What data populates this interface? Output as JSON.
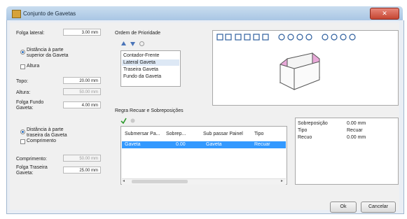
{
  "window": {
    "title": "Conjunto de Gavetas",
    "close_label": "✕"
  },
  "left": {
    "folga_lateral_label": "Folga lateral:",
    "folga_lateral_value": "3.00 mm",
    "radio_top_label": "Distância à parte superior da Gaveta",
    "check_altura_label": "Altura",
    "topo_label": "Topo:",
    "topo_value": "20.00 mm",
    "altura_label": "Altura:",
    "altura_value": "50.00 mm",
    "folga_fundo_label": "Folga Fundo Gaveta:",
    "folga_fundo_value": "4.00 mm",
    "radio_back_label": "Distância à parte traseira da Gaveta",
    "check_comprimento_label": "Comprimento",
    "comprimento_label": "Comprimento:",
    "comprimento_value": "50.00 mm",
    "folga_traseira_label": "Folga Traseira Gaveta:",
    "folga_traseira_value": "25.00 mm"
  },
  "ordem": {
    "title": "Ordem de Prioridade",
    "items": [
      "Contador-Frente",
      "Lateral Gaveta",
      "Traseira Gaveta",
      "Fundo da Gaveta"
    ],
    "selected_index": 1
  },
  "regra": {
    "title": "Regra Recuar e Sobreposições",
    "columns": [
      "Submersar Pa...",
      "Sobrep...",
      "Sub passar Painel",
      "Tipo"
    ],
    "rows": [
      [
        "Gaveta",
        "0.00",
        "Gaveta",
        "Recuar"
      ]
    ]
  },
  "props": {
    "rows": [
      {
        "key": "Sobreposição",
        "value": "0.00 mm"
      },
      {
        "key": "Tipo",
        "value": "Recuar"
      },
      {
        "key": "Recuo",
        "value": "0.00 mm"
      }
    ]
  },
  "buttons": {
    "ok": "Ok",
    "cancel": "Cancelar"
  },
  "colors": {
    "accent": "#3399ff",
    "drawer_face": "#e8a8d8"
  }
}
